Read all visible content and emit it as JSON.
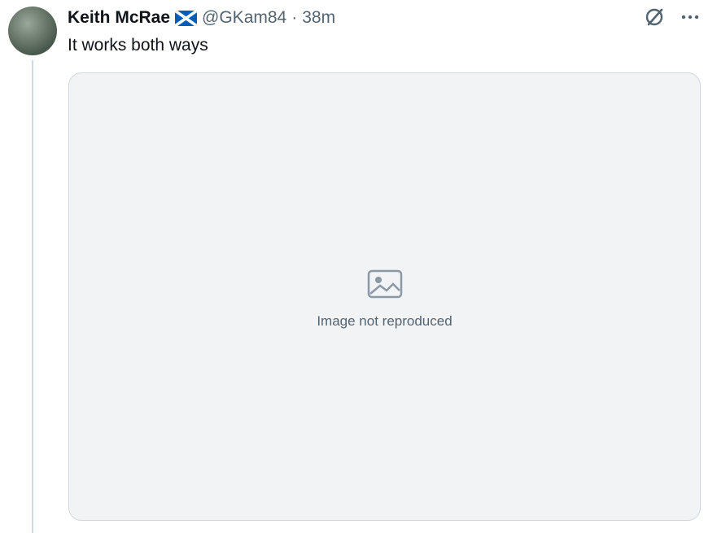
{
  "tweet": {
    "author_name": "Keith McRae",
    "handle": "@GKam84",
    "separator": "·",
    "time": "38m",
    "text": "It works both ways",
    "flag_icon": "scotland-flag-icon"
  },
  "actions": {
    "grok_icon": "grok-icon",
    "more_icon": "more-options-icon"
  },
  "media": {
    "placeholder_text": "Image not reproduced"
  },
  "colors": {
    "text": "#0f1419",
    "muted": "#536471",
    "border": "#cfd9de",
    "flag_blue": "#005eb8"
  }
}
